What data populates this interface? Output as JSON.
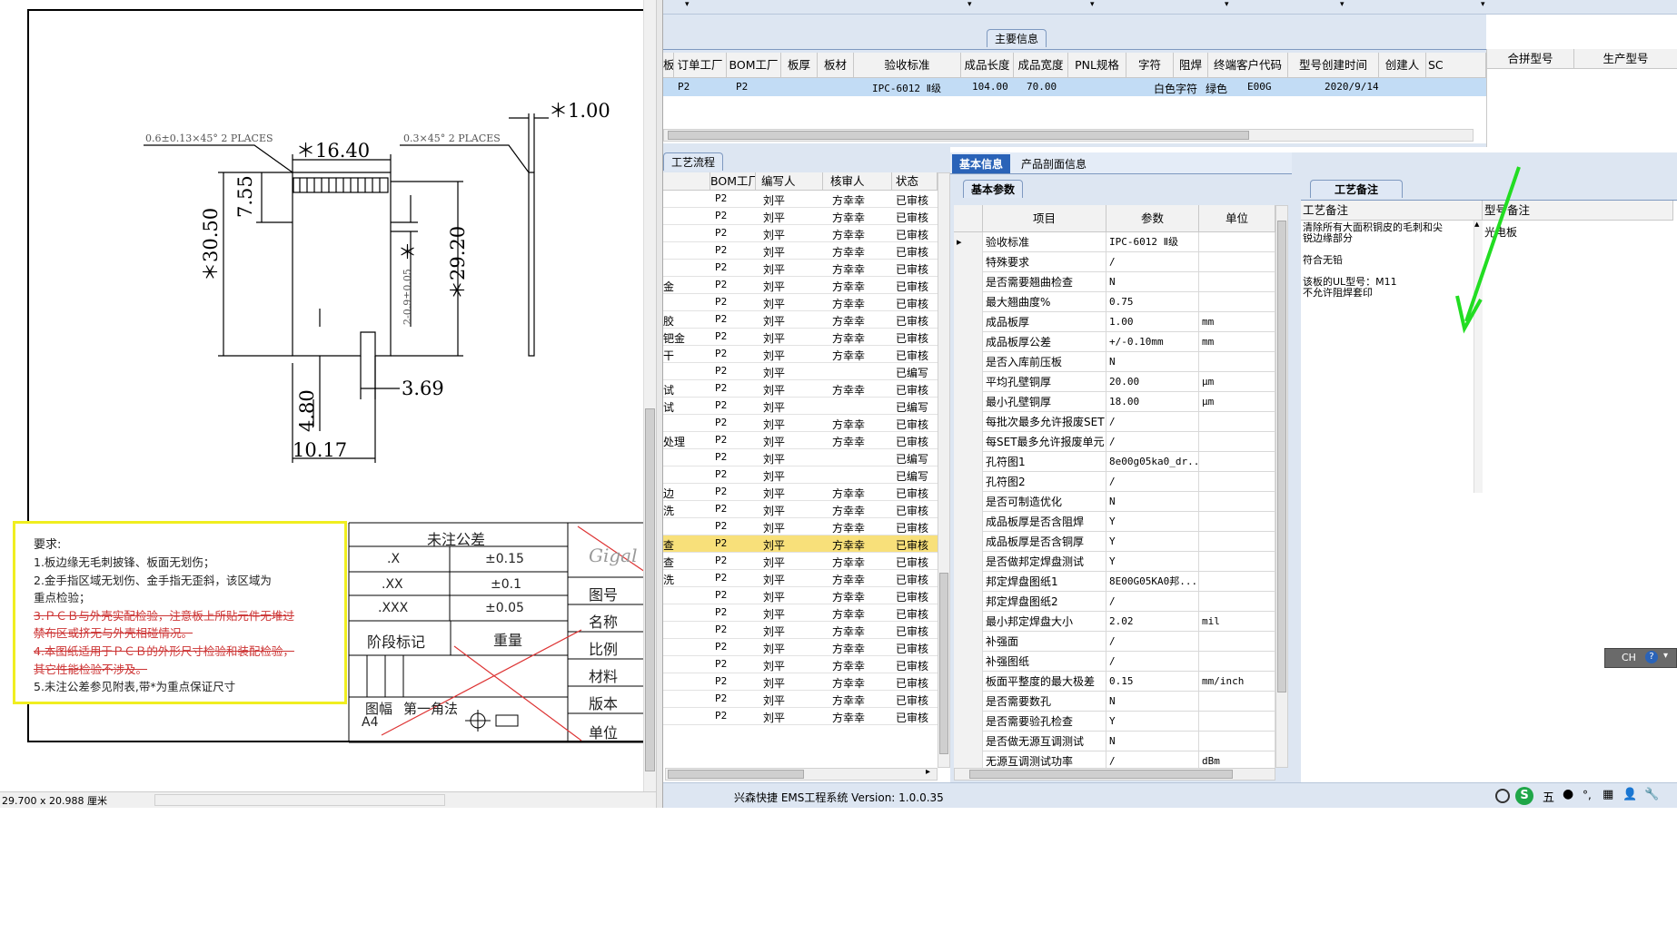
{
  "drawing": {
    "dims": {
      "width_top": "＊16.40",
      "thick": "＊1.00",
      "height_total": "＊30.50",
      "height_right": "＊29.20",
      "h_755": "7.55",
      "h_480": "4.80",
      "w_1017": "10.17",
      "w_369": "3.69",
      "small_vert": "2-0.9±0.05",
      "star": "＊"
    },
    "chamfer_left": "0.6±0.13×45° 2 PLACES",
    "chamfer_right": "0.3×45° 2 PLACES",
    "requirements": {
      "title": "要求:",
      "lines": [
        "1.板边缘无毛刺披锋、板面无划伤；",
        "2.金手指区域无划伤、金手指无歪斜，该区域为",
        "重点检验；",
        "3.ＰＣＢ与外壳实配检验，注意板上所贴元件无堆过",
        "禁布区或挤无与外壳相碰情况。",
        "4.本图纸适用于ＰＣＢ的外形尺寸检验和装配检验，",
        "其它性能检验不涉及。",
        "5.未注公差参见附表,带*为重点保证尺寸"
      ]
    },
    "tolerance_table": {
      "title": "未注公差",
      "rows": [
        {
          "k": ".X",
          "v": "±0.15"
        },
        {
          "k": ".XX",
          "v": "±0.1"
        },
        {
          "k": ".XXX",
          "v": "±0.05"
        }
      ],
      "stage": "阶段标记",
      "weight": "重量",
      "format": "图幅",
      "format_val": "A4",
      "angle": "第一角法",
      "right_labels": [
        "图号",
        "名称",
        "比例",
        "材料",
        "版本",
        "单位"
      ],
      "logo_text": "Gigal"
    },
    "status": "29.700 x 20.988 厘米"
  },
  "main_info": {
    "group_title": "主要信息",
    "columns": [
      "板",
      "订单工厂",
      "BOM工厂",
      "板厚",
      "板材",
      "验收标准",
      "成品长度",
      "成品宽度",
      "PNL规格",
      "字符",
      "阻焊",
      "终端客户代码",
      "型号创建时间",
      "创建人",
      "SC"
    ],
    "row": [
      "",
      "P2",
      "P2",
      "",
      "",
      "IPC-6012 Ⅱ级",
      "104.00",
      "70.00",
      "",
      "白色字符",
      "绿色",
      "E00G",
      "2020/9/14",
      "",
      ""
    ],
    "right_columns": [
      "合拼型号",
      "生产型号"
    ]
  },
  "flow": {
    "tab": "工艺流程",
    "columns": [
      "",
      "BOM工厂",
      "编写人",
      "核审人",
      "状态"
    ],
    "rows": [
      [
        "",
        "P2",
        "刘平",
        "方幸幸",
        "已审核"
      ],
      [
        "",
        "P2",
        "刘平",
        "方幸幸",
        "已审核"
      ],
      [
        "",
        "P2",
        "刘平",
        "方幸幸",
        "已审核"
      ],
      [
        "",
        "P2",
        "刘平",
        "方幸幸",
        "已审核"
      ],
      [
        "",
        "P2",
        "刘平",
        "方幸幸",
        "已审核"
      ],
      [
        "金",
        "P2",
        "刘平",
        "方幸幸",
        "已审核"
      ],
      [
        "",
        "P2",
        "刘平",
        "方幸幸",
        "已审核"
      ],
      [
        "胶",
        "P2",
        "刘平",
        "方幸幸",
        "已审核"
      ],
      [
        "钯金",
        "P2",
        "刘平",
        "方幸幸",
        "已审核"
      ],
      [
        "干",
        "P2",
        "刘平",
        "方幸幸",
        "已审核"
      ],
      [
        "",
        "P2",
        "刘平",
        "",
        "已编写"
      ],
      [
        "试",
        "P2",
        "刘平",
        "方幸幸",
        "已审核"
      ],
      [
        "试",
        "P2",
        "刘平",
        "",
        "已编写"
      ],
      [
        "",
        "P2",
        "刘平",
        "方幸幸",
        "已审核"
      ],
      [
        "处理",
        "P2",
        "刘平",
        "方幸幸",
        "已审核"
      ],
      [
        "",
        "P2",
        "刘平",
        "",
        "已编写"
      ],
      [
        "",
        "P2",
        "刘平",
        "",
        "已编写"
      ],
      [
        "边",
        "P2",
        "刘平",
        "方幸幸",
        "已审核"
      ],
      [
        "洗",
        "P2",
        "刘平",
        "方幸幸",
        "已审核"
      ],
      [
        "",
        "P2",
        "刘平",
        "方幸幸",
        "已审核"
      ],
      [
        "查",
        "P2",
        "刘平",
        "方幸幸",
        "已审核"
      ],
      [
        "查",
        "P2",
        "刘平",
        "方幸幸",
        "已审核"
      ],
      [
        "洗",
        "P2",
        "刘平",
        "方幸幸",
        "已审核"
      ],
      [
        "",
        "P2",
        "刘平",
        "方幸幸",
        "已审核"
      ],
      [
        "",
        "P2",
        "刘平",
        "方幸幸",
        "已审核"
      ],
      [
        "",
        "P2",
        "刘平",
        "方幸幸",
        "已审核"
      ],
      [
        "",
        "P2",
        "刘平",
        "方幸幸",
        "已审核"
      ],
      [
        "",
        "P2",
        "刘平",
        "方幸幸",
        "已审核"
      ],
      [
        "",
        "P2",
        "刘平",
        "方幸幸",
        "已审核"
      ],
      [
        "",
        "P2",
        "刘平",
        "方幸幸",
        "已审核"
      ],
      [
        "",
        "P2",
        "刘平",
        "方幸幸",
        "已审核"
      ]
    ],
    "highlight_index": 20
  },
  "basic": {
    "tab_active": "基本信息",
    "tab_other": "产品剖面信息",
    "subtab": "基本参数",
    "columns": [
      "项目",
      "参数",
      "单位"
    ],
    "rows": [
      [
        "验收标准",
        "IPC-6012 Ⅱ级",
        ""
      ],
      [
        "特殊要求",
        "/",
        ""
      ],
      [
        "是否需要翘曲检查",
        "N",
        ""
      ],
      [
        "最大翘曲度%",
        "0.75",
        ""
      ],
      [
        "成品板厚",
        "1.00",
        "mm"
      ],
      [
        "成品板厚公差",
        "+/-0.10mm",
        "mm"
      ],
      [
        "是否入库前压板",
        "N",
        ""
      ],
      [
        "平均孔壁铜厚",
        "20.00",
        "μm"
      ],
      [
        "最小孔壁铜厚",
        "18.00",
        "μm"
      ],
      [
        "每批次最多允许报废SET",
        "/",
        ""
      ],
      [
        "每SET最多允许报废单元",
        "/",
        ""
      ],
      [
        "孔符图1",
        "8e00g05ka0_dr...",
        ""
      ],
      [
        "孔符图2",
        "/",
        ""
      ],
      [
        "是否可制造优化",
        "N",
        ""
      ],
      [
        "成品板厚是否含阻焊",
        "Y",
        ""
      ],
      [
        "成品板厚是否含铜厚",
        "Y",
        ""
      ],
      [
        "是否做邦定焊盘测试",
        "Y",
        ""
      ],
      [
        "邦定焊盘图纸1",
        "8E00G05KA0邦...",
        ""
      ],
      [
        "邦定焊盘图纸2",
        "/",
        ""
      ],
      [
        "最小邦定焊盘大小",
        "2.02",
        "mil"
      ],
      [
        "补强面",
        "/",
        ""
      ],
      [
        "补强图纸",
        "/",
        ""
      ],
      [
        "板面平整度的最大极差",
        "0.15",
        "mm/inch"
      ],
      [
        "是否需要数孔",
        "N",
        ""
      ],
      [
        "是否需要验孔检查",
        "Y",
        ""
      ],
      [
        "是否做无源互调测试",
        "N",
        ""
      ],
      [
        "无源互调测试功率",
        "/",
        "dBm"
      ]
    ]
  },
  "notes": {
    "tab": "工艺备注",
    "col1": "工艺备注",
    "col2": "型号备注",
    "text1": [
      "清除所有大面积铜皮的毛刺和尖",
      "锐边缘部分",
      "",
      "符合无铅",
      "",
      "该板的UL型号：M11",
      "不允许阻焊套印"
    ],
    "text2": "光电板",
    "arrow_color": "#22dd22"
  },
  "statusbar": {
    "text": "兴森快捷 EMS工程系统 Version: 1.0.0.35",
    "ime": "CH",
    "tray": "五"
  }
}
